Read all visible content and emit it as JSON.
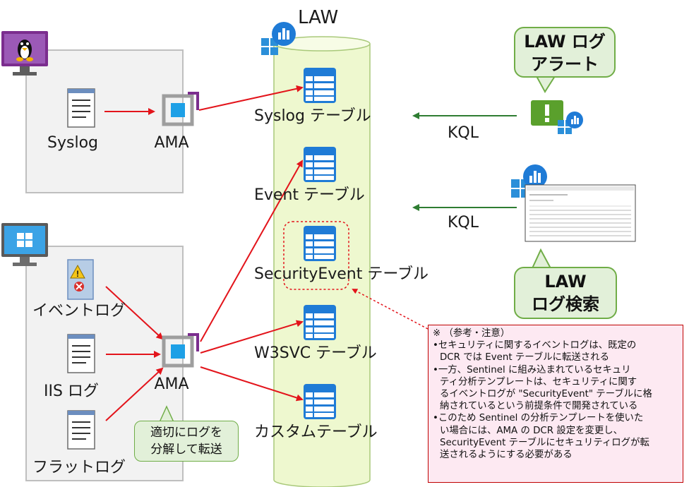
{
  "law_label": "LAW",
  "tables": [
    {
      "label": "Syslog テーブル"
    },
    {
      "label": "Event テーブル"
    },
    {
      "label": "SecurityEvent テーブル"
    },
    {
      "label": "W3SVC テーブル"
    },
    {
      "label": "カスタムテーブル"
    }
  ],
  "linux": {
    "source_label": "Syslog",
    "agent_label": "AMA"
  },
  "windows": {
    "sources": [
      {
        "label": "イベントログ"
      },
      {
        "label": "IIS ログ"
      },
      {
        "label": "フラットログ"
      }
    ],
    "agent_label": "AMA",
    "callout_line1": "適切にログを",
    "callout_line2": "分解して転送"
  },
  "alert": {
    "callout_line1": "LAW ログ",
    "callout_line2": "アラート",
    "query_label": "KQL"
  },
  "search": {
    "callout_line1": "LAW",
    "callout_line2": "ログ検索",
    "query_label": "KQL"
  },
  "note": {
    "lines": [
      {
        "text": "※ （参考・注意）",
        "indent": false
      },
      {
        "text": "•セキュリティに関するイベントログは、既定の",
        "indent": false
      },
      {
        "text": "DCR では Event テーブルに転送される",
        "indent": true
      },
      {
        "text": "•一方、Sentinel に組み込まれているセキュリ",
        "indent": false
      },
      {
        "text": "ティ分析テンプレートは、セキュリティに関す",
        "indent": true
      },
      {
        "text": "るイベントログが \"SecurityEvent\" テーブルに格",
        "indent": true
      },
      {
        "text": "納されているという前提条件で開発されている",
        "indent": true
      },
      {
        "text": "•このため Sentinel の分析テンプレートを使いた",
        "indent": false
      },
      {
        "text": "い場合には、AMA の DCR 設定を変更し、",
        "indent": true
      },
      {
        "text": "SecurityEvent テーブルにセキュリティログが転",
        "indent": true
      },
      {
        "text": "送されるようにする必要がある",
        "indent": true
      }
    ]
  },
  "colors": {
    "cylinder_fill": "#eef8cf",
    "cylinder_stroke": "#a9c97a",
    "table_icon": "#1f7bd6",
    "arrow_red": "#e3141b",
    "arrow_green": "#2e7d32",
    "linux_monitor": "#7b2d8e",
    "windows_monitor": "#1e88c8",
    "callout_fill": "#e2f0d9",
    "callout_border": "#70ad47",
    "note_fill": "#fde9f2",
    "note_border": "#c00000"
  }
}
